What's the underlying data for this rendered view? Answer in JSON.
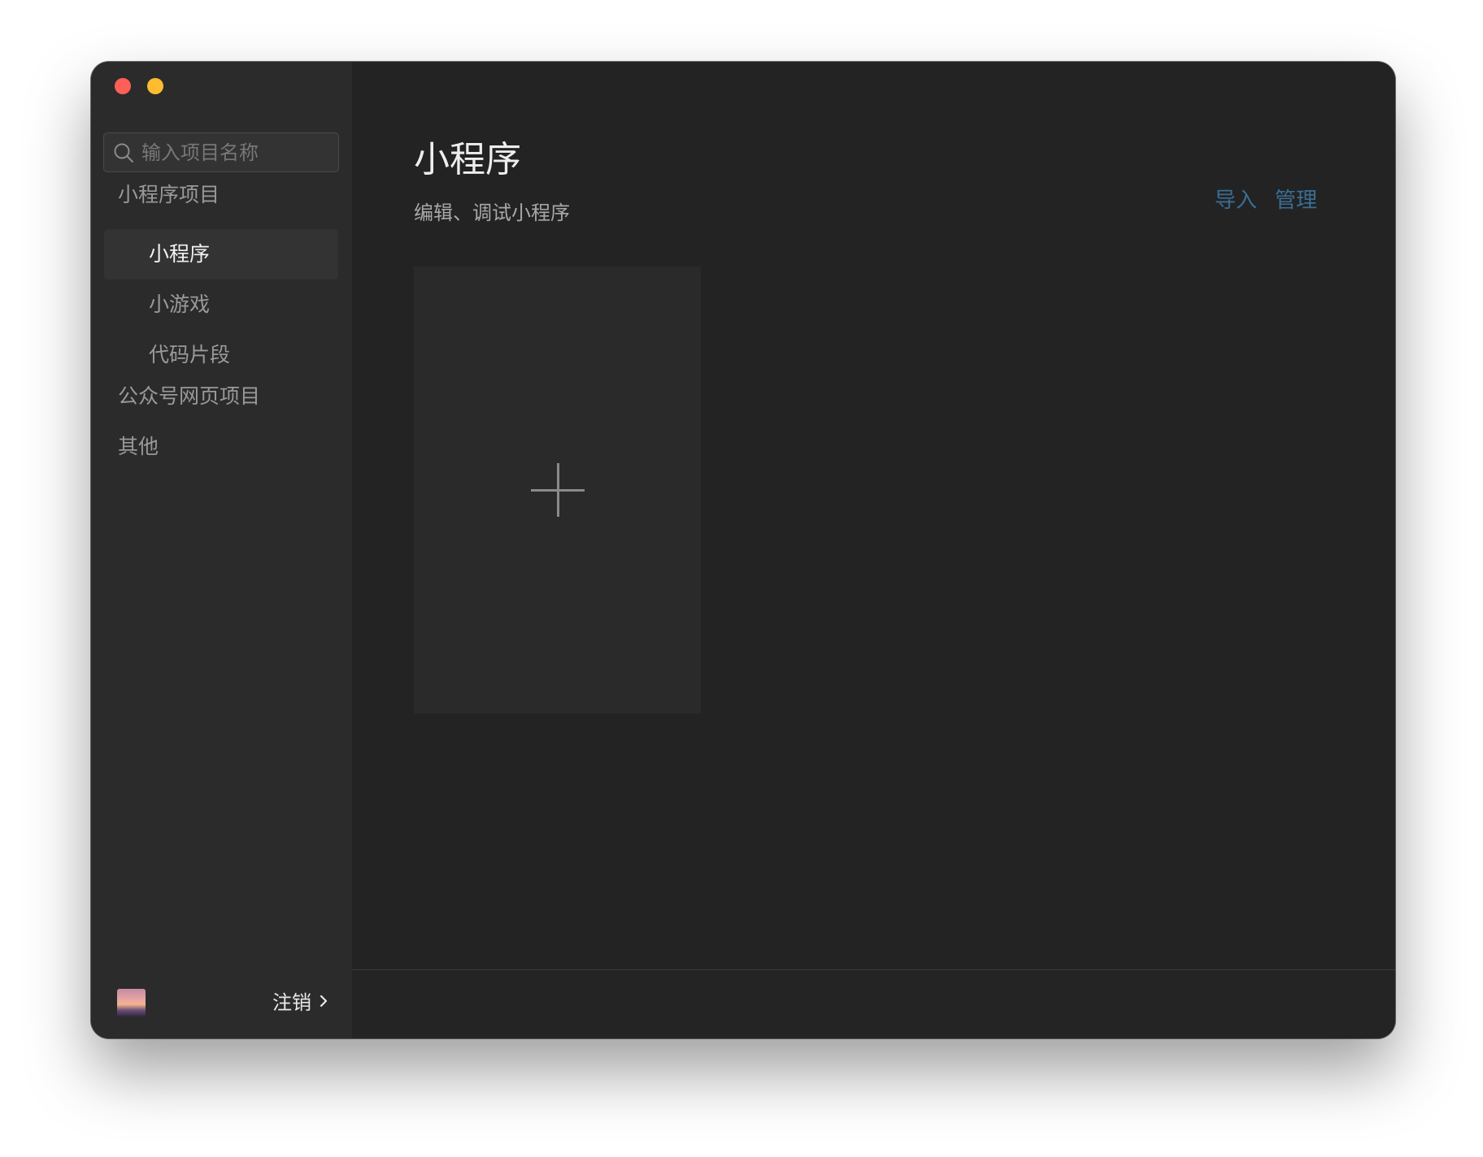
{
  "window": {
    "controls": [
      "close",
      "minimize"
    ]
  },
  "sidebar": {
    "search": {
      "placeholder": "输入项目名称",
      "value": ""
    },
    "groups": [
      {
        "label": "小程序项目",
        "items": [
          {
            "label": "小程序",
            "active": true
          },
          {
            "label": "小游戏",
            "active": false
          },
          {
            "label": "代码片段",
            "active": false
          }
        ]
      },
      {
        "label": "公众号网页项目",
        "items": []
      },
      {
        "label": "其他",
        "items": []
      }
    ],
    "footer": {
      "logout_label": "注销"
    }
  },
  "main": {
    "title": "小程序",
    "subtitle": "编辑、调试小程序",
    "actions": {
      "import_label": "导入",
      "manage_label": "管理"
    }
  },
  "colors": {
    "close": "#fe5f57",
    "minimize": "#febc2e",
    "link": "#3a6e94",
    "sidebar_bg": "#2b2b2b",
    "main_bg": "#232323",
    "active_item_bg": "#333333"
  },
  "icons": {
    "search": "search-icon",
    "new_project": "plus-icon",
    "logout_chevron": "chevron-right-icon"
  }
}
